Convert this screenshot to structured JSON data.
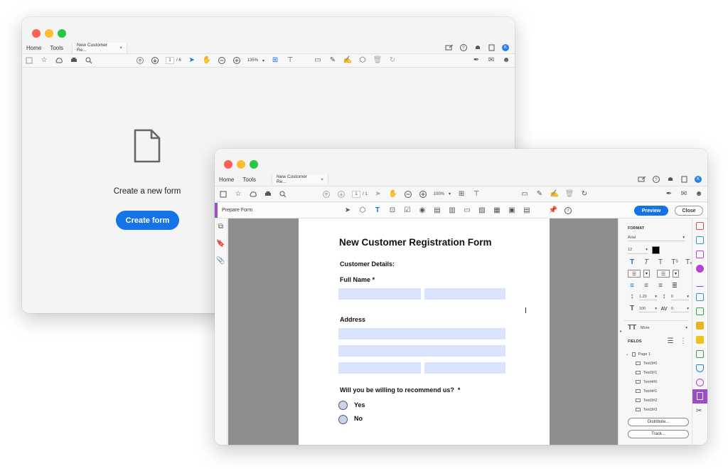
{
  "back_window": {
    "nav_tabs": [
      "Home",
      "Tools"
    ],
    "doc_tab": "New Customer Re...",
    "doc_tab_close": "×",
    "avatar_initial": "K",
    "page_current": "1",
    "page_total": "/ 6",
    "zoom": "135%",
    "create_new_form_label": "Create a new form",
    "create_form_button": "Create form"
  },
  "front_window": {
    "nav_tabs": [
      "Home",
      "Tools"
    ],
    "doc_tab": "New Customer Re...",
    "doc_tab_close": "×",
    "avatar_initial": "K",
    "page_current": "1",
    "page_total": "/ 1",
    "zoom": "100%",
    "prepare_form_label": "Prepare Form",
    "preview_button": "Preview",
    "close_button": "Close",
    "form": {
      "title": "New Customer Registration Form",
      "customer_details": "Customer Details:",
      "full_name": "Full Name *",
      "address": "Address",
      "recommend_question": "Will you be willing to recommend us?  *",
      "yes": "Yes",
      "no": "No"
    },
    "right_panel": {
      "format_title": "FORMAT",
      "font": "Arial",
      "font_size": "12",
      "line_spacing": "1.20",
      "para_spacing": "0",
      "scale": "100",
      "tracking": "0",
      "more_label": "More",
      "fields_title": "FIELDS",
      "page_node": "Page 1",
      "fields": [
        "Text3#0",
        "Text3#1",
        "Text4#0",
        "Text4#1",
        "Text3#2",
        "Text3#3"
      ],
      "distribute_button": "Distribute...",
      "track_button": "Track..."
    }
  },
  "colors": {
    "accent_blue": "#1473e6",
    "field_fill": "#dbe4fe",
    "prepare_form_accent": "#9b4dca"
  }
}
